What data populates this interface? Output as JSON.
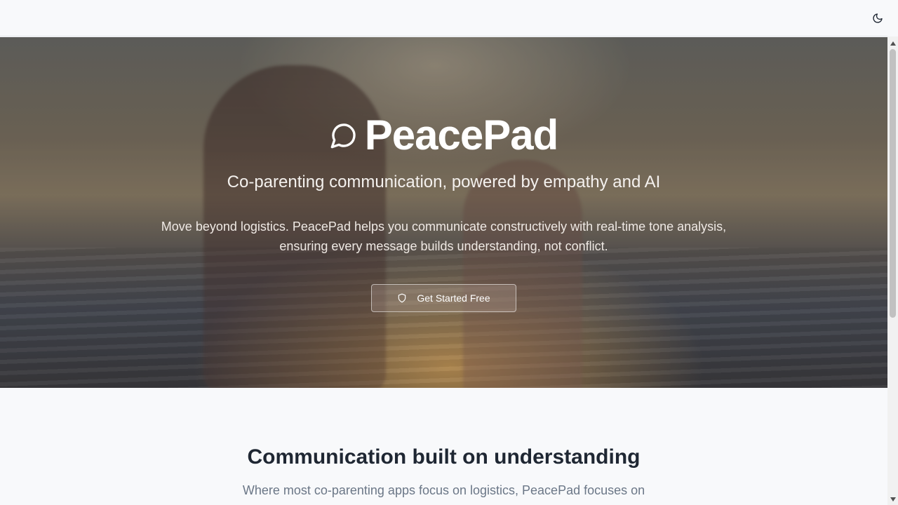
{
  "header": {
    "theme_toggle_icon": "moon-icon"
  },
  "hero": {
    "logo_icon": "message-circle-icon",
    "brand_name": "PeacePad",
    "tagline": "Co-parenting communication, powered by empathy and AI",
    "description": "Move beyond logistics. PeacePad helps you communicate constructively with real-time tone analysis, ensuring every message builds understanding, not conflict.",
    "cta": {
      "icon": "shield-icon",
      "label": "Get Started Free"
    }
  },
  "section": {
    "title": "Communication built on understanding",
    "subtitle": "Where most co-parenting apps focus on logistics, PeacePad focuses on"
  },
  "colors": {
    "page_bg": "#f8f9fb",
    "heading": "#1f2733",
    "subtext": "#6b7787"
  }
}
